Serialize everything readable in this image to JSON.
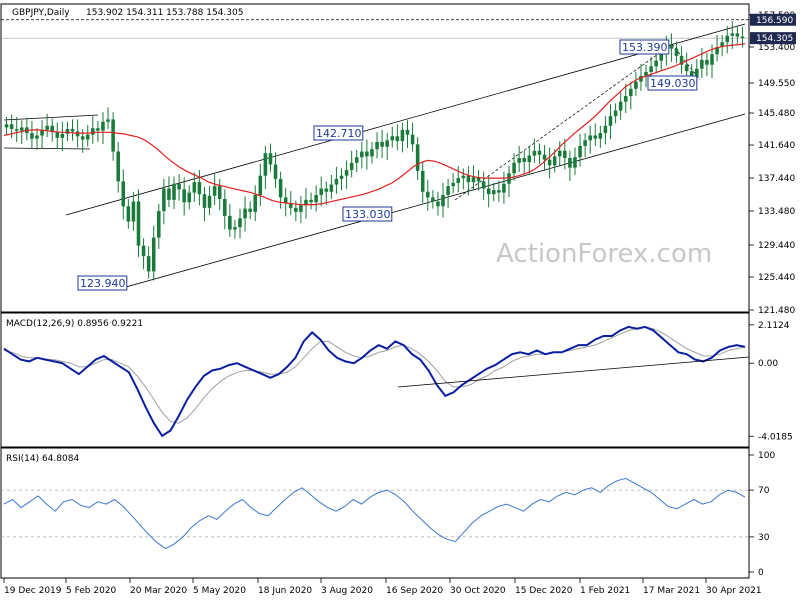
{
  "chart_data": [
    {
      "type": "candlestick",
      "title": "GBPJPY,Daily",
      "ohlc_header": "153.902 154.311 153.788 154.305",
      "y_ticks": [
        "157.590",
        "153.400",
        "149.550",
        "145.480",
        "141.640",
        "137.440",
        "133.480",
        "129.440",
        "125.440",
        "121.480"
      ],
      "ylim": [
        120.5,
        158.3
      ],
      "grid": false,
      "last_price": "154.305",
      "level_price": "156.590",
      "annotations": [
        {
          "text": "123.940",
          "value": 123.94
        },
        {
          "text": "142.710",
          "value": 142.71
        },
        {
          "text": "133.030",
          "value": 133.03
        },
        {
          "text": "153.390",
          "value": 153.39
        },
        {
          "text": "149.030",
          "value": 149.03
        }
      ],
      "close_approx": [
        143.6,
        143.0,
        142.8,
        143.2,
        142.5,
        141.8,
        142.2,
        142.9,
        143.4,
        142.6,
        141.9,
        142.4,
        143.0,
        142.7,
        142.1,
        141.7,
        142.3,
        143.1,
        142.8,
        143.9,
        144.2,
        140.2,
        136.5,
        133.4,
        131.5,
        134.0,
        128.5,
        127.2,
        125.3,
        129.5,
        132.8,
        135.6,
        134.2,
        136.2,
        135.5,
        133.9,
        135.1,
        136.4,
        134.9,
        133.2,
        134.7,
        135.9,
        134.3,
        132.2,
        130.5,
        130.8,
        131.9,
        133.1,
        132.7,
        134.8,
        137.2,
        140.0,
        138.6,
        136.8,
        134.5,
        133.8,
        133.2,
        132.7,
        133.5,
        134.2,
        133.9,
        134.8,
        135.6,
        135.2,
        136.1,
        136.8,
        137.2,
        137.9,
        138.8,
        139.5,
        140.2,
        139.6,
        140.5,
        141.4,
        140.8,
        141.6,
        142.1,
        141.5,
        142.9,
        142.3,
        141.1,
        137.8,
        135.2,
        134.5,
        134.0,
        133.4,
        134.8,
        135.9,
        136.3,
        136.9,
        137.2,
        136.4,
        137.0,
        136.5,
        135.6,
        134.9,
        135.4,
        135.1,
        136.2,
        137.5,
        138.8,
        139.4,
        138.9,
        139.7,
        140.3,
        139.8,
        139.2,
        138.5,
        139.6,
        140.3,
        139.4,
        138.2,
        139.5,
        140.9,
        141.6,
        142.2,
        141.8,
        142.5,
        143.4,
        144.6,
        145.3,
        146.4,
        147.1,
        148.0,
        148.9,
        149.6,
        150.1,
        150.8,
        151.5,
        152.3,
        153.4,
        153.0,
        152.1,
        151.0,
        150.2,
        149.4,
        150.5,
        151.6,
        151.0,
        152.3,
        153.2,
        153.8,
        154.6,
        154.9,
        154.5,
        154.3
      ],
      "ma_approx": [
        142.2,
        142.4,
        142.6,
        142.8,
        142.9,
        142.9,
        142.8,
        142.7,
        142.6,
        142.6,
        142.5,
        142.5,
        142.5,
        142.6,
        142.6,
        142.6,
        142.5,
        142.4,
        142.2,
        142.0,
        141.6,
        141.0,
        140.3,
        139.5,
        138.8,
        138.2,
        137.7,
        137.3,
        136.9,
        136.4,
        136.1,
        135.9,
        135.7,
        135.5,
        135.3,
        135.1,
        134.8,
        134.5,
        134.1,
        133.9,
        133.8,
        133.7,
        133.6,
        133.6,
        133.6,
        133.7,
        133.9,
        134.1,
        134.3,
        134.5,
        134.7,
        134.9,
        135.2,
        135.5,
        135.9,
        136.3,
        136.9,
        137.6,
        138.3,
        138.8,
        139.1,
        139.0,
        138.7,
        138.3,
        137.9,
        137.5,
        137.2,
        137.0,
        136.9,
        136.9,
        136.9,
        136.9,
        137.0,
        137.2,
        137.5,
        137.9,
        138.5,
        139.3,
        140.1,
        141.0,
        141.8,
        142.6,
        143.3,
        144.0,
        144.8,
        145.7,
        146.6,
        147.4,
        148.2,
        148.8,
        149.3,
        149.6,
        149.9,
        150.2,
        150.5,
        150.8,
        151.2,
        151.6,
        152.0,
        152.4,
        152.8,
        153.1,
        153.3,
        153.4,
        153.5,
        153.6
      ]
    },
    {
      "type": "line",
      "title": "MACD(12,26,9) 0.8956 0.9221",
      "y_ticks": [
        "2.1124",
        "0.00",
        "-4.0185"
      ],
      "ylim": [
        -4.5,
        2.6
      ],
      "series": [
        {
          "values": [
            0.8,
            0.5,
            0.2,
            0.1,
            0.3,
            0.2,
            0.1,
            0.0,
            -0.3,
            -0.6,
            -0.2,
            0.2,
            0.4,
            0.1,
            -0.2,
            -0.5,
            -1.4,
            -2.4,
            -3.3,
            -4.0,
            -3.7,
            -2.9,
            -2.0,
            -1.3,
            -0.7,
            -0.4,
            -0.3,
            -0.1,
            0.0,
            -0.2,
            -0.4,
            -0.6,
            -0.8,
            -0.6,
            -0.2,
            0.3,
            1.2,
            1.7,
            1.3,
            0.7,
            0.3,
            0.1,
            0.0,
            0.3,
            0.7,
            1.0,
            0.8,
            1.2,
            1.0,
            0.5,
            0.2,
            -0.4,
            -1.2,
            -1.8,
            -1.6,
            -1.2,
            -0.9,
            -0.6,
            -0.3,
            -0.1,
            0.2,
            0.5,
            0.6,
            0.5,
            0.7,
            0.5,
            0.6,
            0.6,
            0.8,
            1.0,
            1.0,
            1.3,
            1.5,
            1.5,
            1.8,
            2.0,
            1.9,
            2.0,
            1.8,
            1.4,
            1.0,
            0.6,
            0.5,
            0.2,
            0.1,
            0.3,
            0.7,
            0.9,
            1.0,
            0.9
          ]
        }
      ],
      "signal": [
        0.7,
        0.6,
        0.4,
        0.3,
        0.3,
        0.2,
        0.2,
        0.1,
        0.0,
        -0.2,
        -0.2,
        0.0,
        0.2,
        0.2,
        0.0,
        -0.2,
        -0.7,
        -1.3,
        -2.0,
        -2.7,
        -3.2,
        -3.3,
        -3.0,
        -2.5,
        -1.9,
        -1.4,
        -1.0,
        -0.7,
        -0.5,
        -0.4,
        -0.4,
        -0.5,
        -0.6,
        -0.6,
        -0.5,
        -0.2,
        0.3,
        0.8,
        1.2,
        1.2,
        0.9,
        0.6,
        0.4,
        0.3,
        0.4,
        0.6,
        0.7,
        0.9,
        1.0,
        0.8,
        0.5,
        0.1,
        -0.4,
        -1.0,
        -1.3,
        -1.3,
        -1.2,
        -0.9,
        -0.7,
        -0.4,
        -0.2,
        0.1,
        0.3,
        0.4,
        0.5,
        0.5,
        0.6,
        0.6,
        0.7,
        0.8,
        0.9,
        1.0,
        1.2,
        1.4,
        1.6,
        1.8,
        1.9,
        2.0,
        1.9,
        1.7,
        1.4,
        1.1,
        0.8,
        0.6,
        0.4,
        0.4,
        0.5,
        0.7,
        0.8,
        0.9
      ]
    },
    {
      "type": "line",
      "title": "RSI(14) 64.8084",
      "y_ticks": [
        "100",
        "70",
        "30",
        "0"
      ],
      "ylim": [
        0,
        100
      ],
      "series": [
        {
          "values": [
            58,
            62,
            55,
            60,
            65,
            58,
            52,
            60,
            62,
            57,
            55,
            60,
            58,
            62,
            56,
            48,
            40,
            32,
            25,
            20,
            24,
            30,
            38,
            44,
            48,
            45,
            52,
            58,
            62,
            55,
            50,
            48,
            55,
            62,
            68,
            72,
            66,
            60,
            55,
            52,
            56,
            62,
            58,
            64,
            68,
            70,
            66,
            60,
            52,
            45,
            38,
            32,
            28,
            26,
            34,
            42,
            48,
            52,
            56,
            58,
            55,
            52,
            58,
            62,
            60,
            65,
            68,
            66,
            70,
            72,
            68,
            74,
            78,
            80,
            76,
            72,
            68,
            62,
            56,
            54,
            58,
            62,
            58,
            60,
            66,
            70,
            68,
            64
          ]
        }
      ]
    }
  ],
  "x_labels": [
    "19 Dec 2019",
    "5 Feb 2020",
    "20 Mar 2020",
    "5 May 2020",
    "18 Jun 2020",
    "3 Aug 2020",
    "16 Sep 2020",
    "30 Oct 2020",
    "15 Dec 2020",
    "1 Feb 2021",
    "17 Mar 2021",
    "30 Apr 2021"
  ],
  "watermark": "ActionForex.com",
  "colors": {
    "candle": "#1a7a3a",
    "ma": "#e02020",
    "macd": "#0a1ea0",
    "signal": "#a0a0a0",
    "rsi": "#3a78d0",
    "trend": "#000000",
    "box": "#1f3a93",
    "tag": "#1f2a50"
  }
}
